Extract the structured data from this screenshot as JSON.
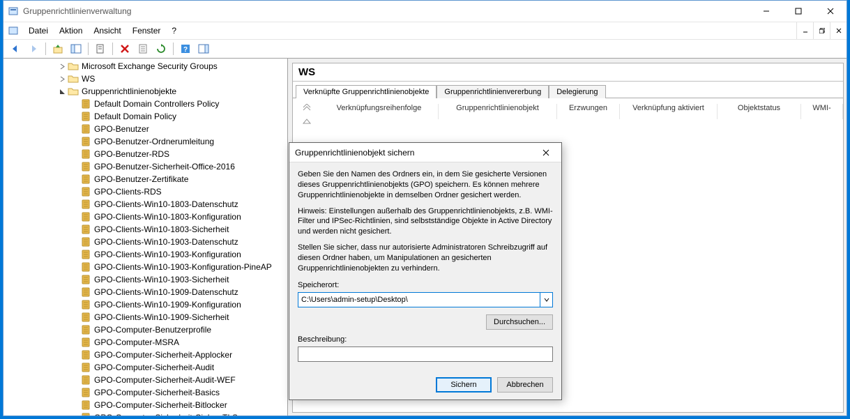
{
  "window": {
    "title": "Gruppenrichtlinienverwaltung"
  },
  "menu": {
    "items": [
      "Datei",
      "Aktion",
      "Ansicht",
      "Fenster",
      "?"
    ]
  },
  "tree": {
    "top": [
      {
        "indent": 72,
        "exp": "closed",
        "icon": "folder",
        "label": "Microsoft Exchange Security Groups"
      },
      {
        "indent": 72,
        "exp": "closed",
        "icon": "folder",
        "label": "WS"
      },
      {
        "indent": 72,
        "exp": "open",
        "icon": "folder",
        "label": "Gruppenrichtlinienobjekte"
      }
    ],
    "gpos": [
      "Default Domain Controllers Policy",
      "Default Domain Policy",
      "GPO-Benutzer",
      "GPO-Benutzer-Ordnerumleitung",
      "GPO-Benutzer-RDS",
      "GPO-Benutzer-Sicherheit-Office-2016",
      "GPO-Benutzer-Zertifikate",
      "GPO-Clients-RDS",
      "GPO-Clients-Win10-1803-Datenschutz",
      "GPO-Clients-Win10-1803-Konfiguration",
      "GPO-Clients-Win10-1803-Sicherheit",
      "GPO-Clients-Win10-1903-Datenschutz",
      "GPO-Clients-Win10-1903-Konfiguration",
      "GPO-Clients-Win10-1903-Konfiguration-PineAP",
      "GPO-Clients-Win10-1903-Sicherheit",
      "GPO-Clients-Win10-1909-Datenschutz",
      "GPO-Clients-Win10-1909-Konfiguration",
      "GPO-Clients-Win10-1909-Sicherheit",
      "GPO-Computer-Benutzerprofile",
      "GPO-Computer-MSRA",
      "GPO-Computer-Sicherheit-Applocker",
      "GPO-Computer-Sicherheit-Audit",
      "GPO-Computer-Sicherheit-Audit-WEF",
      "GPO-Computer-Sicherheit-Basics",
      "GPO-Computer-Sicherheit-Bitlocker",
      "GPO-Computer-Sicherheit-Cipher-TLS"
    ]
  },
  "details": {
    "ou": "WS",
    "tabs": [
      "Verknüpfte Gruppenrichtlinienobjekte",
      "Gruppenrichtlinienvererbung",
      "Delegierung"
    ],
    "columns": [
      "Verknüpfungsreihenfolge",
      "Gruppenrichtlinienobjekt",
      "Erzwungen",
      "Verknüpfung aktiviert",
      "Objektstatus",
      "WMI-"
    ]
  },
  "dialog": {
    "title": "Gruppenrichtlinienobjekt sichern",
    "p1": "Geben Sie den Namen des Ordners ein, in dem Sie gesicherte Versionen dieses Gruppenrichtlinienobjekts (GPO) speichern. Es können mehrere Gruppenrichtlinienobjekte in demselben Ordner gesichert werden.",
    "p2": "Hinweis: Einstellungen außerhalb des Gruppenrichtlinienobjekts, z.B. WMI-Filter und IPSec-Richtlinien, sind selbstständige Objekte in Active Directory und werden nicht gesichert.",
    "p3": "Stellen Sie sicher, dass nur autorisierte Administratoren Schreibzugriff auf diesen Ordner haben, um Manipulationen an gesicherten Gruppenrichtlinienobjekten zu verhindern.",
    "location_label": "Speicherort:",
    "location_value": "C:\\Users\\admin-setup\\Desktop\\",
    "browse": "Durchsuchen...",
    "desc_label": "Beschreibung:",
    "desc_value": "",
    "ok": "Sichern",
    "cancel": "Abbrechen"
  }
}
